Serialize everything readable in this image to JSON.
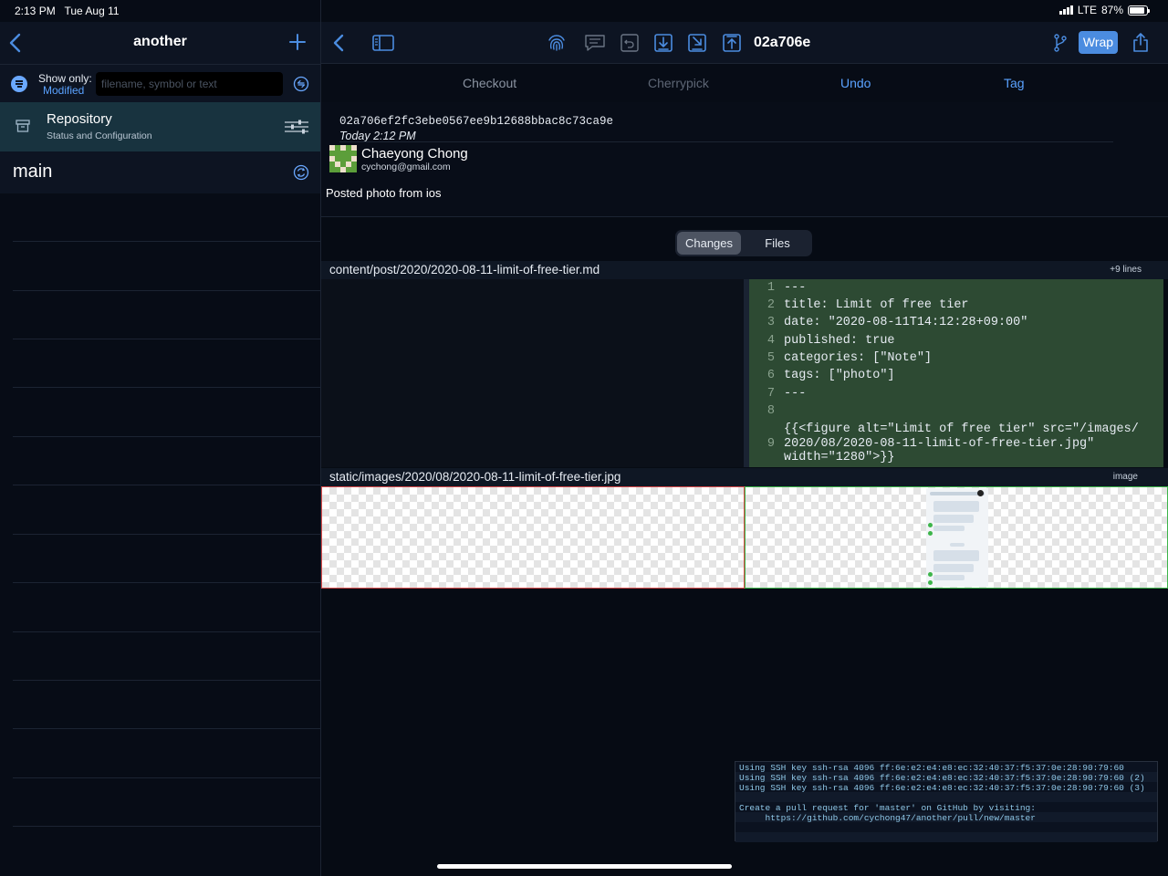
{
  "status_bar": {
    "time": "2:13 PM",
    "date": "Tue Aug 11",
    "network": "LTE",
    "battery": "87%"
  },
  "sidebar": {
    "title": "another",
    "filter": {
      "show_only_label": "Show only:",
      "show_only_value": "Modified",
      "placeholder": "filename, symbol or text"
    },
    "repository": {
      "title": "Repository",
      "subtitle": "Status and Configuration"
    },
    "branch": "main"
  },
  "toolbar": {
    "commit_short": "02a706e",
    "wrap_label": "Wrap"
  },
  "actions": {
    "checkout": "Checkout",
    "cherrypick": "Cherrypick",
    "undo": "Undo",
    "tag": "Tag"
  },
  "commit": {
    "hash": "02a706ef2fc3ebe0567ee9b12688bbac8c73ca9e",
    "date": "Today 2:12 PM",
    "author_name": "Chaeyong Chong",
    "author_email": "cychong@gmail.com",
    "message": "Posted photo from ios"
  },
  "segmented": {
    "changes": "Changes",
    "files": "Files"
  },
  "files": [
    {
      "path": "content/post/2020/2020-08-11-limit-of-free-tier.md",
      "badge": "+9 lines",
      "lines": [
        {
          "n": "1",
          "text": "---"
        },
        {
          "n": "2",
          "text": "title: Limit of free tier"
        },
        {
          "n": "3",
          "text": "date: \"2020-08-11T14:12:28+09:00\""
        },
        {
          "n": "4",
          "text": "published: true"
        },
        {
          "n": "5",
          "text": "categories: [\"Note\"]"
        },
        {
          "n": "6",
          "text": "tags: [\"photo\"]"
        },
        {
          "n": "7",
          "text": "---"
        },
        {
          "n": "8",
          "text": ""
        },
        {
          "n": "9",
          "text": "{{<figure alt=\"Limit of free tier\" src=\"/images/\n2020/08/2020-08-11-limit-of-free-tier.jpg\"\nwidth=\"1280\">}}"
        }
      ]
    },
    {
      "path": "static/images/2020/08/2020-08-11-limit-of-free-tier.jpg",
      "badge": "image"
    }
  ],
  "console": [
    "Using SSH key ssh-rsa 4096 ff:6e:e2:e4:e8:ec:32:40:37:f5:37:0e:28:90:79:60",
    "Using SSH key ssh-rsa 4096 ff:6e:e2:e4:e8:ec:32:40:37:f5:37:0e:28:90:79:60 (2)",
    "Using SSH key ssh-rsa 4096 ff:6e:e2:e4:e8:ec:32:40:37:f5:37:0e:28:90:79:60 (3)",
    "",
    "Create a pull request for 'master' on GitHub by visiting:",
    "     https://github.com/cychong47/another/pull/new/master"
  ],
  "colors": {
    "accent": "#4b8ce0",
    "link": "#5aa2ff",
    "added_bg": "#2d4a33",
    "removed_border": "#d84a4a",
    "added_border": "#3db54a"
  }
}
